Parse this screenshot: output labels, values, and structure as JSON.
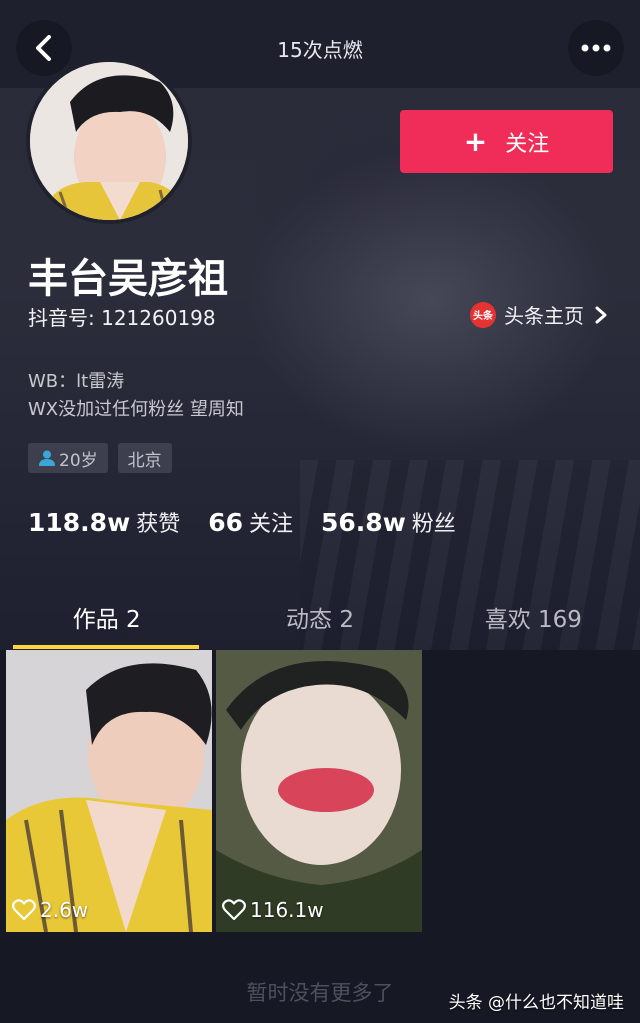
{
  "header": {
    "title": "15次点燃",
    "back_icon": "back-arrow-icon",
    "more_icon": "more-dots-icon"
  },
  "profile": {
    "follow_label": "关注",
    "follow_color": "#f02d58",
    "name": "丰台吴彦祖",
    "id_text": "抖音号: 121260198",
    "toutiao_badge": "头条",
    "toutiao_label": "头条主页",
    "bio": [
      "WB：lt雷涛",
      "WX没加过任何粉丝 望周知"
    ],
    "tags": {
      "age": "20岁",
      "city": "北京"
    }
  },
  "stats": [
    {
      "value": "118.8w",
      "label": "获赞"
    },
    {
      "value": "66",
      "label": "关注"
    },
    {
      "value": "56.8w",
      "label": "粉丝"
    }
  ],
  "tabs": [
    {
      "label": "作品 2",
      "active": true
    },
    {
      "label": "动态 2",
      "active": false
    },
    {
      "label": "喜欢 169",
      "active": false
    }
  ],
  "tab_indicator_color": "#fcd53a",
  "videos": [
    {
      "likes": "2.6w"
    },
    {
      "likes": "116.1w"
    }
  ],
  "footer": {
    "no_more": "暂时没有更多了",
    "watermark": "头条 @什么也不知道哇"
  }
}
